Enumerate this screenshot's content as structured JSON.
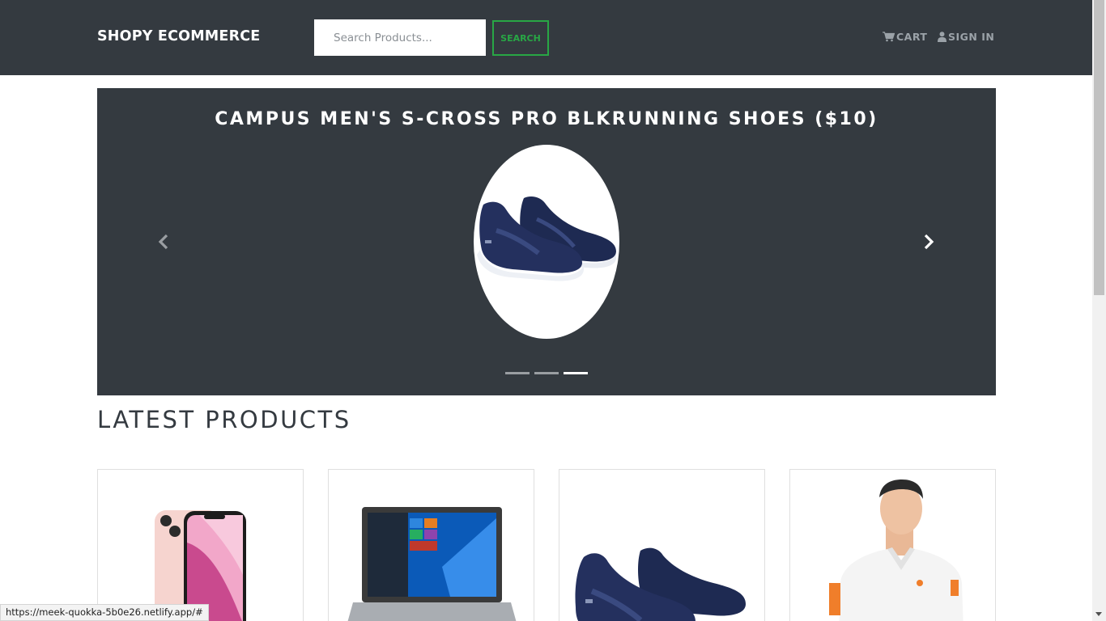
{
  "header": {
    "brand": "SHOPY ECOMMERCE",
    "search_placeholder": "Search Products...",
    "search_button": "SEARCH",
    "cart_label": "CART",
    "signin_label": "SIGN IN"
  },
  "carousel": {
    "title": "CAMPUS MEN'S S-CROSS PRO BLKRUNNING SHOES ($10)",
    "slide_count": 3,
    "active_slide": 3
  },
  "section": {
    "title": "LATEST PRODUCTS"
  },
  "products": [
    {
      "image": "iphone-image"
    },
    {
      "image": "laptop-image"
    },
    {
      "image": "shoes-image"
    },
    {
      "image": "polo-shirt-image"
    }
  ],
  "status_bar": {
    "url": "https://meek-quokka-5b0e26.netlify.app/#"
  },
  "colors": {
    "navbar_bg": "#343a40",
    "accent_green": "#28a745",
    "nav_link": "#9ba2a8"
  }
}
